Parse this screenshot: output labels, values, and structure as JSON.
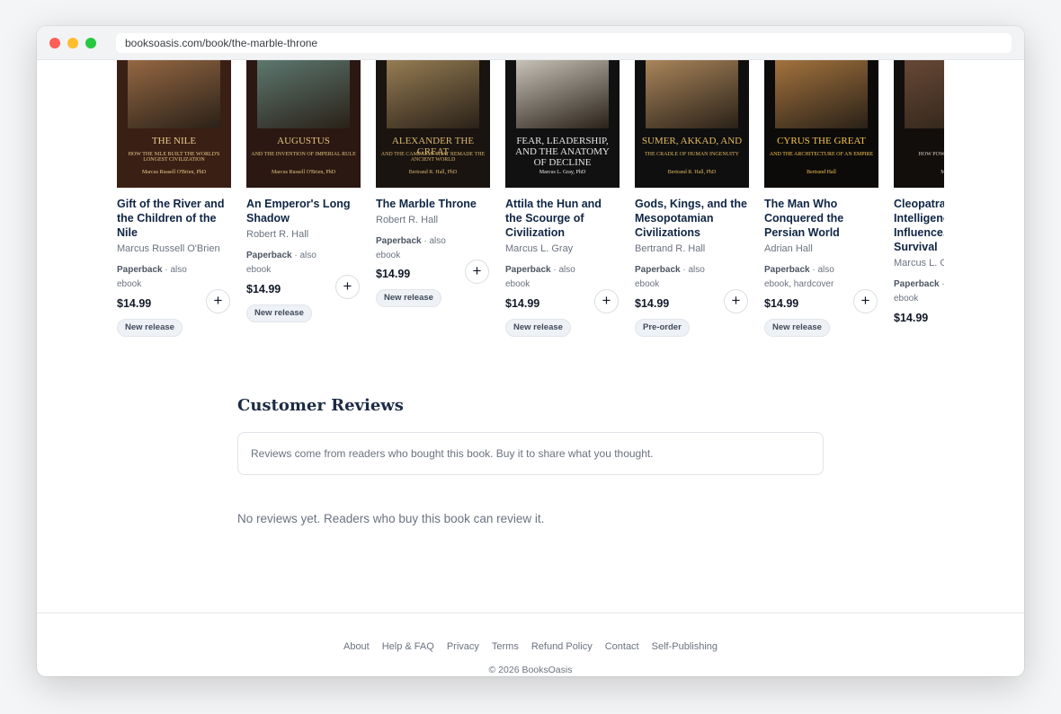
{
  "browser": {
    "url": "booksoasis.com/book/the-marble-throne"
  },
  "colors": {
    "accent": "#0f2544",
    "muted": "#6b7280",
    "badge_bg": "#eef1f5"
  },
  "books": [
    {
      "title": "Gift of the River and the Children of the Nile",
      "author": "Marcus Russell O'Brien",
      "format": "Paperback",
      "format_note": " · also ebook",
      "price": "$14.99",
      "badge": "New release",
      "add_label": "+",
      "cover": {
        "top_text": "THE NILE",
        "mid_text": "HOW THE NILE BUILT THE WORLD'S LONGEST CIVILIZATION",
        "author_text": "Marcus Russell O'Brien, PhD",
        "bg": "#3a1f14",
        "art": "#9a6b45",
        "text_color": "#e8c98a"
      }
    },
    {
      "title": "An Emperor's Long Shadow",
      "author": "Robert R. Hall",
      "format": "Paperback",
      "format_note": " · also ebook",
      "price": "$14.99",
      "badge": "New release",
      "add_label": "+",
      "cover": {
        "top_text": "AUGUSTUS",
        "mid_text": "AND THE INVENTION OF IMPERIAL RULE",
        "author_text": "Marcus Russell O'Brien, PhD",
        "bg": "#2b1812",
        "art": "#5f7c74",
        "text_color": "#e3c27e"
      }
    },
    {
      "title": "The Marble Throne",
      "author": "Robert R. Hall",
      "format": "Paperback",
      "format_note": " · also ebook",
      "price": "$14.99",
      "badge": "New release",
      "add_label": "+",
      "cover": {
        "top_text": "ALEXANDER THE GREAT",
        "mid_text": "AND THE CAMPAIGN THAT REMADE THE ANCIENT WORLD",
        "author_text": "Bertrand R. Hall, PhD",
        "bg": "#1a1410",
        "art": "#9b8156",
        "text_color": "#d8b56c"
      }
    },
    {
      "title": "Attila the Hun and the Scourge of Civilization",
      "author": "Marcus L. Gray",
      "format": "Paperback",
      "format_note": " · also ebook",
      "price": "$14.99",
      "badge": "New release",
      "add_label": "+",
      "cover": {
        "top_text": "FEAR, LEADERSHIP, AND THE ANATOMY OF DECLINE",
        "mid_text": "",
        "author_text": "Marcus L. Gray, PhD",
        "bg": "#111111",
        "art": "#cfcac0",
        "text_color": "#e5e5e5"
      }
    },
    {
      "title": "Gods, Kings, and the Mesopotamian Civilizations",
      "author": "Bertrand R. Hall",
      "format": "Paperback",
      "format_note": " · also ebook",
      "price": "$14.99",
      "badge": "Pre-order",
      "add_label": "+",
      "cover": {
        "top_text": "SUMER, AKKAD, AND",
        "mid_text": "THE CRADLE OF HUMAN INGENUITY",
        "author_text": "Bertrand R. Hall, PhD",
        "bg": "#0f0f0f",
        "art": "#b08a5e",
        "text_color": "#e2b960"
      }
    },
    {
      "title": "The Man Who Conquered the Persian World",
      "author": "Adrian Hall",
      "format": "Paperback",
      "format_note": " · also ebook, hardcover",
      "price": "$14.99",
      "badge": "New release",
      "add_label": "+",
      "cover": {
        "top_text": "CYRUS THE GREAT",
        "mid_text": "AND THE ARCHITECTURE OF AN EMPIRE",
        "author_text": "Bertrand Hall",
        "bg": "#0d0b09",
        "art": "#a9773f",
        "text_color": "#f2c14e"
      }
    },
    {
      "title": "Cleopatra's Intelligence, Influence, and Survival",
      "author": "Marcus L. Gray",
      "format": "Paperback",
      "format_note": " · also ebook",
      "price": "$14.99",
      "badge": "",
      "add_label": "",
      "cover": {
        "top_text": "",
        "mid_text": "HOW POWER... EDGE OF...",
        "author_text": "Marcus...",
        "bg": "#120e0c",
        "art": "#6b4a37",
        "text_color": "#d9d0c4"
      }
    }
  ],
  "reviews": {
    "heading": "Customer Reviews",
    "notice": "Reviews come from readers who bought this book. Buy it to share what you thought.",
    "empty": "No reviews yet. Readers who buy this book can review it."
  },
  "footer": {
    "links": [
      "About",
      "Help & FAQ",
      "Privacy",
      "Terms",
      "Refund Policy",
      "Contact",
      "Self-Publishing"
    ],
    "copyright": "© 2026 BooksOasis"
  }
}
